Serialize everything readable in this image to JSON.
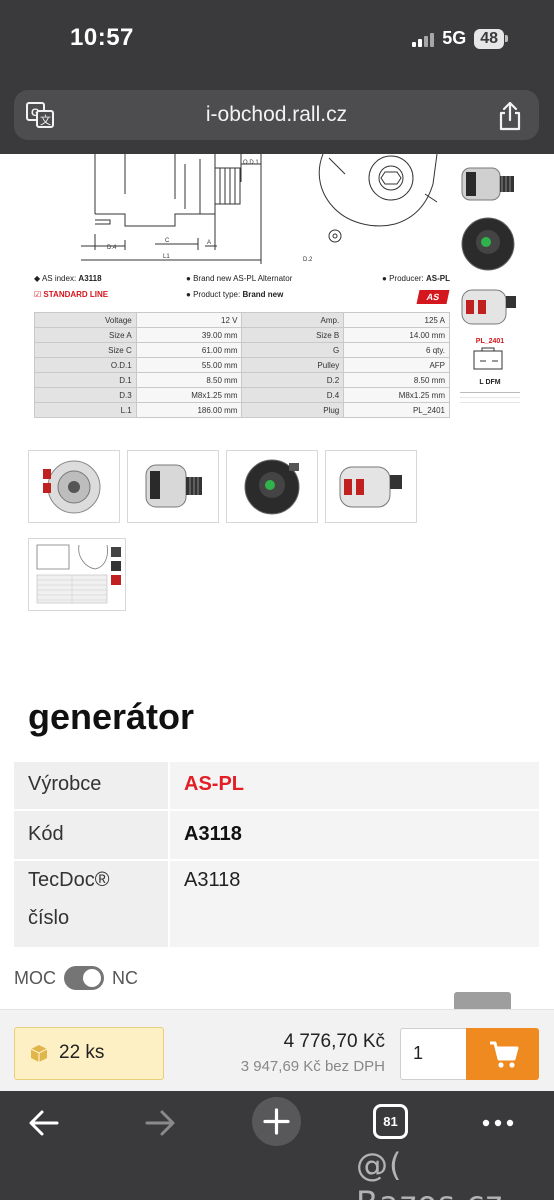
{
  "status": {
    "time": "10:57",
    "network": "5G",
    "battery": "48"
  },
  "browser": {
    "url": "i-obchod.rall.cz",
    "tab_count": "81"
  },
  "datasheet": {
    "drawing_labels": {
      "od1": "O.D.1",
      "d4": "D.4",
      "c": "C",
      "a": "A",
      "l1": "L1",
      "d2": "D.2"
    },
    "as_index_label": "AS index:",
    "as_index_value": "A3118",
    "standard_line": "STANDARD LINE",
    "description": "Brand new AS-PL Alternator",
    "product_type_label": "Product type:",
    "product_type_value": "Brand new",
    "producer_label": "Producer:",
    "producer_value": "AS-PL",
    "logo_text": "AS",
    "rows": [
      {
        "k1": "Voltage",
        "v1": "12 V",
        "k2": "Amp.",
        "v2": "125 A"
      },
      {
        "k1": "Size A",
        "v1": "39.00 mm",
        "k2": "Size B",
        "v2": "14.00 mm"
      },
      {
        "k1": "Size C",
        "v1": "61.00 mm",
        "k2": "G",
        "v2": "6 qty."
      },
      {
        "k1": "O.D.1",
        "v1": "55.00 mm",
        "k2": "Pulley",
        "v2": "AFP"
      },
      {
        "k1": "D.1",
        "v1": "8.50 mm",
        "k2": "D.2",
        "v2": "8.50 mm"
      },
      {
        "k1": "D.3",
        "v1": "M8x1.25 mm",
        "k2": "D.4",
        "v2": "M8x1.25 mm"
      },
      {
        "k1": "L.1",
        "v1": "186.00 mm",
        "k2": "Plug",
        "v2": "PL_2401"
      }
    ],
    "plug_label": "PL_2401",
    "plug_pins": "L  DFM"
  },
  "product": {
    "title": "generátor",
    "rows": [
      {
        "key": "Výrobce",
        "value": "AS-PL"
      },
      {
        "key": "Kód",
        "value": "A3118"
      },
      {
        "key": "TecDoc® číslo",
        "value": "A3118"
      }
    ]
  },
  "toggle": {
    "left": "MOC",
    "right": "NC"
  },
  "purchase": {
    "stock": "22 ks",
    "price": "4 776,70 Kč",
    "price_net": "3 947,69 Kč bez DPH",
    "quantity": "1"
  },
  "watermark": "@( Bazos.cz",
  "colors": {
    "brand_red": "#e31e24",
    "cart_orange": "#ef8a21",
    "stock_bg": "#fdf0c4",
    "chrome": "#3a3a3c"
  },
  "icons": [
    "translate-icon",
    "share-icon",
    "box-icon",
    "cart-icon",
    "chevron-up-icon",
    "back-arrow-icon",
    "forward-arrow-icon",
    "plus-icon",
    "tabs-icon",
    "more-icon"
  ]
}
